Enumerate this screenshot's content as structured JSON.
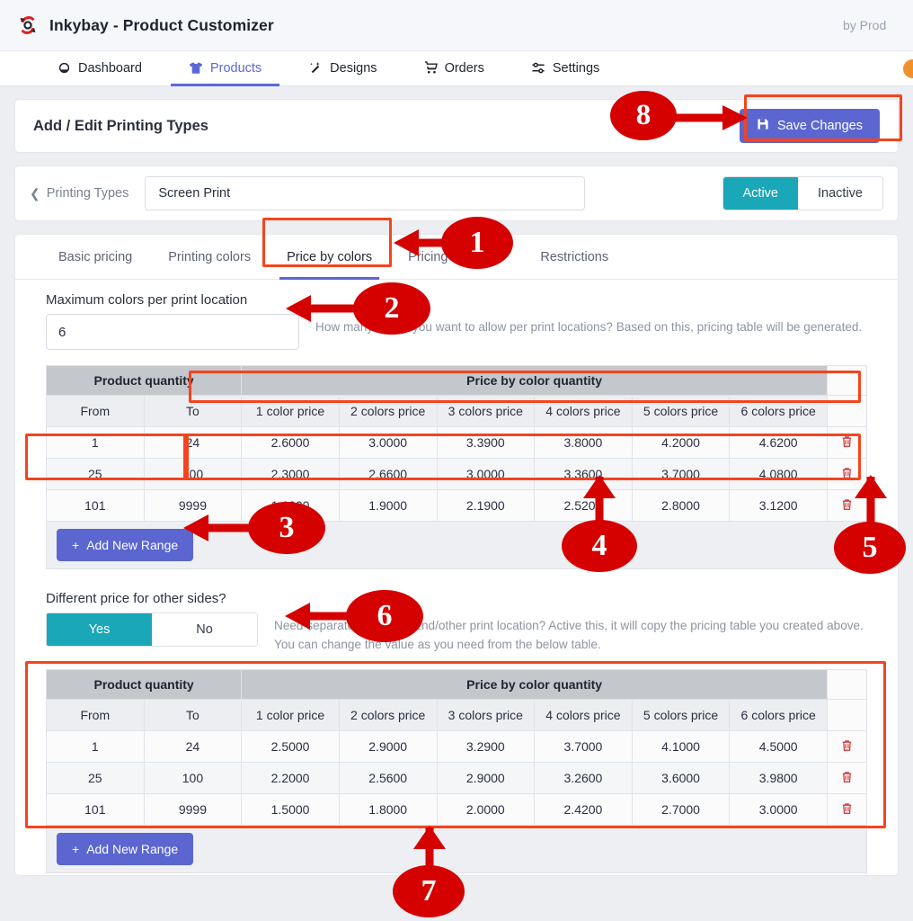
{
  "topbar": {
    "brand_title": "Inkybay - Product Customizer",
    "logo_icon": "inkybay-logo-icon",
    "by_text": "by Prod"
  },
  "nav": {
    "items": [
      {
        "label": "Dashboard",
        "icon": "speedometer-icon",
        "active": false
      },
      {
        "label": "Products",
        "icon": "tshirt-icon",
        "active": true
      },
      {
        "label": "Designs",
        "icon": "magic-wand-icon",
        "active": false
      },
      {
        "label": "Orders",
        "icon": "shopping-cart-icon",
        "active": false
      },
      {
        "label": "Settings",
        "icon": "sliders-icon",
        "active": false
      }
    ],
    "avatar": "user-avatar"
  },
  "header_card": {
    "title": "Add / Edit Printing Types",
    "save_label": "Save Changes",
    "save_icon": "floppy-disk-icon",
    "save_color": "#5b66d0"
  },
  "printing_type_bar": {
    "back_label": "Printing Types",
    "back_icon": "chevron-left-icon",
    "name_value": "Screen Print",
    "name_placeholder": "Screen Print",
    "status_options": [
      "Active",
      "Inactive"
    ],
    "status_selected": "Active",
    "active_color": "#1aa7b8"
  },
  "tabs": [
    {
      "label": "Basic pricing",
      "active": false
    },
    {
      "label": "Printing colors",
      "active": false
    },
    {
      "label": "Price by colors",
      "active": true
    },
    {
      "label": "Pricing by image",
      "active": false
    },
    {
      "label": "Restrictions",
      "active": false
    }
  ],
  "max_colors": {
    "label": "Maximum colors per print location",
    "value": "6",
    "placeholder": "6",
    "helper": "How many colors you want to allow per print locations? Based on this, pricing table will be generated."
  },
  "table_primary": {
    "group_headers": {
      "quantity": "Product quantity",
      "price": "Price by color quantity"
    },
    "columns": [
      "From",
      "To",
      "1 color price",
      "2 colors price",
      "3 colors price",
      "4 colors price",
      "5 colors price",
      "6 colors price"
    ],
    "rows": [
      {
        "from": "1",
        "to": "24",
        "prices": [
          "2.6000",
          "3.0000",
          "3.3900",
          "3.8000",
          "4.2000",
          "4.6200"
        ]
      },
      {
        "from": "25",
        "to": "100",
        "prices": [
          "2.3000",
          "2.6600",
          "3.0000",
          "3.3600",
          "3.7000",
          "4.0800"
        ]
      },
      {
        "from": "101",
        "to": "9999",
        "prices": [
          "1.6000",
          "1.9000",
          "2.1900",
          "2.5200",
          "2.8000",
          "3.1200"
        ]
      }
    ],
    "delete_icon": "trash-icon",
    "add_label": "Add New Range",
    "add_icon": "plus-icon"
  },
  "other_sides": {
    "label": "Different price for other sides?",
    "options": [
      "Yes",
      "No"
    ],
    "selected": "Yes",
    "helper": "Need separate pricing for 2nd/other print location? Active this, it will copy the pricing table you created above. You can change the value as you need from the below table."
  },
  "table_secondary": {
    "group_headers": {
      "quantity": "Product quantity",
      "price": "Price by color quantity"
    },
    "columns": [
      "From",
      "To",
      "1 color price",
      "2 colors price",
      "3 colors price",
      "4 colors price",
      "5 colors price",
      "6 colors price"
    ],
    "rows": [
      {
        "from": "1",
        "to": "24",
        "prices": [
          "2.5000",
          "2.9000",
          "3.2900",
          "3.7000",
          "4.1000",
          "4.5000"
        ]
      },
      {
        "from": "25",
        "to": "100",
        "prices": [
          "2.2000",
          "2.5600",
          "2.9000",
          "3.2600",
          "3.6000",
          "3.9800"
        ]
      },
      {
        "from": "101",
        "to": "9999",
        "prices": [
          "1.5000",
          "1.8000",
          "2.0000",
          "2.4200",
          "2.7000",
          "3.0000"
        ]
      }
    ],
    "delete_icon": "trash-icon",
    "add_label": "Add New Range",
    "add_icon": "plus-icon"
  },
  "annotations": {
    "color": "#d50000",
    "box_color": "#f4441e",
    "markers": [
      {
        "n": "1",
        "target": "price-by-colors-tab"
      },
      {
        "n": "2",
        "target": "max-colors-input"
      },
      {
        "n": "3",
        "target": "add-new-range-button-primary"
      },
      {
        "n": "4",
        "target": "price-row-25-100"
      },
      {
        "n": "5",
        "target": "delete-row-icon"
      },
      {
        "n": "6",
        "target": "other-sides-toggle"
      },
      {
        "n": "7",
        "target": "secondary-pricing-table"
      },
      {
        "n": "8",
        "target": "save-changes-button"
      }
    ]
  }
}
